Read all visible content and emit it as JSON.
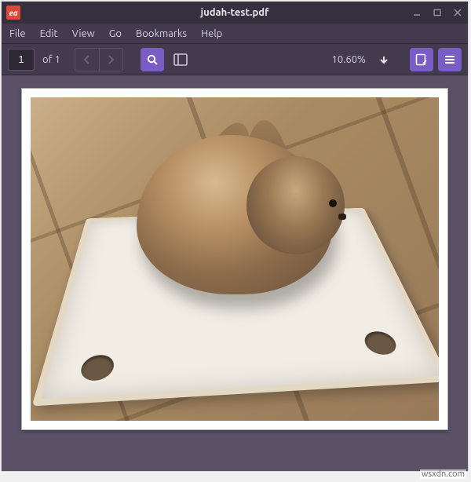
{
  "titlebar": {
    "title": "judah-test.pdf",
    "app_icon_label": "ea"
  },
  "menubar": {
    "items": [
      "File",
      "Edit",
      "View",
      "Go",
      "Bookmarks",
      "Help"
    ]
  },
  "toolbar": {
    "page_current": "1",
    "page_of": "of 1",
    "zoom_label": "10.60%"
  },
  "watermark": "wsxdn.com"
}
